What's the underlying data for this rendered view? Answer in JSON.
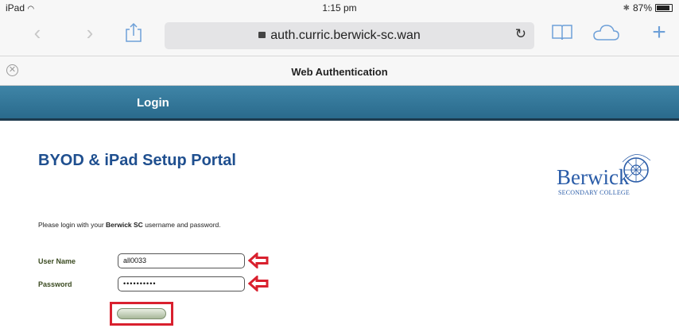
{
  "status_bar": {
    "device": "iPad",
    "time": "1:15 pm",
    "battery": "87%"
  },
  "browser": {
    "url": "auth.curric.berwick-sc.wan",
    "tab_title": "Web Authentication"
  },
  "login_bar": {
    "label": "Login"
  },
  "page": {
    "heading": "BYOD & iPad Setup Portal",
    "logo": {
      "name": "Berwick",
      "subtitle": "SECONDARY COLLEGE"
    },
    "instruction": {
      "before": "Please login with your ",
      "bold": "Berwick SC",
      "after": " username and password."
    },
    "form": {
      "username_label": "User Name",
      "username_value": "all0033",
      "password_label": "Password",
      "password_value": "••••••••••"
    }
  },
  "colors": {
    "accent": "#d9202e",
    "header": "#3f85a7",
    "title": "#1f4f8f"
  }
}
